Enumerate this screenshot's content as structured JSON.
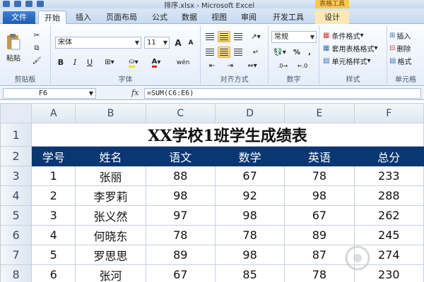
{
  "window": {
    "title": "排序.xlsx - Microsoft Excel",
    "context_tab_label": "表格工具"
  },
  "tabs": [
    {
      "label": "文件"
    },
    {
      "label": "开始"
    },
    {
      "label": "插入"
    },
    {
      "label": "页面布局"
    },
    {
      "label": "公式"
    },
    {
      "label": "数据"
    },
    {
      "label": "视图"
    },
    {
      "label": "审阅"
    },
    {
      "label": "开发工具"
    },
    {
      "label": "设计"
    }
  ],
  "ribbon": {
    "clipboard": {
      "paste_label": "粘贴",
      "group_label": "剪贴板"
    },
    "font": {
      "font_name": "宋体",
      "font_size": "11",
      "grow": "A",
      "shrink": "A",
      "bold": "B",
      "italic": "I",
      "underline": "U",
      "change_case": "wén",
      "group_label": "字体"
    },
    "alignment": {
      "group_label": "对齐方式"
    },
    "number": {
      "format": "常规",
      "percent": "%",
      "comma": ",",
      "group_label": "数字"
    },
    "styles": {
      "conditional": "条件格式",
      "table_format": "套用表格格式",
      "cell_styles": "单元格样式",
      "group_label": "样式"
    },
    "cells": {
      "insert": "插入",
      "delete": "删除",
      "format": "格式",
      "group_label": "单元格"
    }
  },
  "formula_bar": {
    "name_box": "F6",
    "fx": "fx",
    "formula": "=SUM(C6:E6)"
  },
  "sheet": {
    "columns": [
      "A",
      "B",
      "C",
      "D",
      "E",
      "F"
    ],
    "rows": [
      "1",
      "2",
      "3",
      "4",
      "5",
      "6",
      "7",
      "8"
    ],
    "title": "XX学校1班学生成绩表",
    "headers": [
      "学号",
      "姓名",
      "语文",
      "数学",
      "英语",
      "总分"
    ],
    "data": [
      [
        "1",
        "张丽",
        "88",
        "67",
        "78",
        "233"
      ],
      [
        "2",
        "李罗莉",
        "98",
        "92",
        "98",
        "288"
      ],
      [
        "3",
        "张义然",
        "97",
        "98",
        "67",
        "262"
      ],
      [
        "4",
        "何晓东",
        "78",
        "78",
        "89",
        "245"
      ],
      [
        "5",
        "罗思思",
        "89",
        "98",
        "87",
        "274"
      ],
      [
        "6",
        "张河",
        "67",
        "85",
        "78",
        "230"
      ]
    ]
  },
  "colors": {
    "header_fill": "#0a3672",
    "file_tab": "#2a6bc0",
    "ribbon_bg": "#e4edf9"
  }
}
